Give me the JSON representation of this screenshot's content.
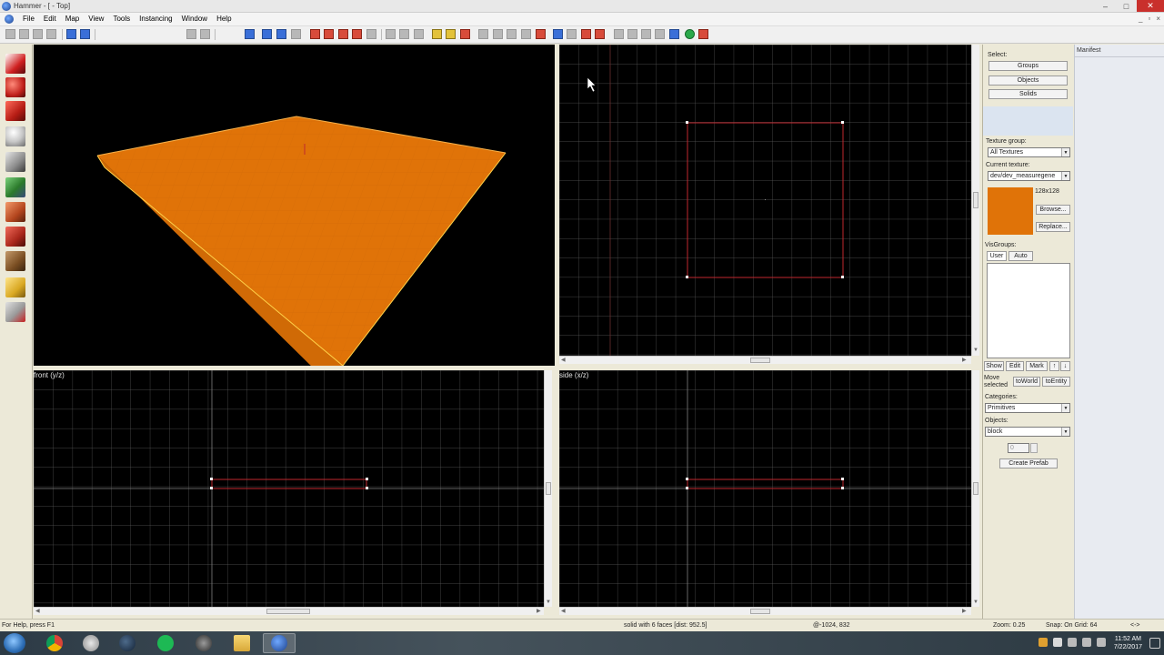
{
  "window": {
    "title": "Hammer - [ - Top]",
    "controls": [
      "–",
      "□",
      "✕"
    ]
  },
  "menu": {
    "items": [
      "File",
      "Edit",
      "Map",
      "View",
      "Tools",
      "Instancing",
      "Window",
      "Help"
    ],
    "mdi_controls": [
      "_",
      "▫",
      "×"
    ]
  },
  "viewports": {
    "camera": {
      "label": ""
    },
    "top": {
      "label": ""
    },
    "front": {
      "label": "front (y/z)"
    },
    "side": {
      "label": "side (x/z)"
    }
  },
  "colors": {
    "block_face": "#e07308",
    "block_edge": "#ffd24a",
    "selection": "#c0282e",
    "grid_line": "#5a5a5a",
    "grid_axis": "#8a8a8a"
  },
  "right_panel": {
    "select_label": "Select:",
    "select_buttons": [
      "Groups",
      "Objects",
      "Solids"
    ],
    "texture_group_label": "Texture group:",
    "texture_group_value": "All Textures",
    "current_texture_label": "Current texture:",
    "current_texture_value": "dev/dev_measuregene",
    "texture_size": "128x128",
    "browse_label": "Browse...",
    "replace_label": "Replace...",
    "visgroups_label": "VisGroups:",
    "visgroup_tabs": [
      "User",
      "Auto"
    ],
    "show_label": "Show",
    "edit_label": "Edit",
    "mark_label": "Mark",
    "up_label": "↑",
    "down_label": "↓",
    "move_selected_label": "Move selected",
    "to_world_label": "toWorld",
    "to_entity_label": "toEntity",
    "categories_label": "Categories:",
    "categories_value": "Primitives",
    "objects_label": "Objects:",
    "objects_value": "block",
    "face_count_value": "0",
    "create_prefab_label": "Create Prefab"
  },
  "manifest": {
    "header": "Manifest"
  },
  "status": {
    "help": "For Help, press F1",
    "selection": "solid with 6 faces   [dist: 952.5]",
    "coords": "@-1024, 832",
    "zoom": "Zoom: 0.25",
    "snap": "Snap: On Grid: 64",
    "extra": "<->"
  },
  "taskbar": {
    "apps": [
      "chrome",
      "spotify-helper",
      "steam",
      "spotify",
      "source-sdk",
      "file-explorer",
      "hammer"
    ],
    "clock_time": "11:52 AM",
    "clock_date": "7/22/2017"
  }
}
